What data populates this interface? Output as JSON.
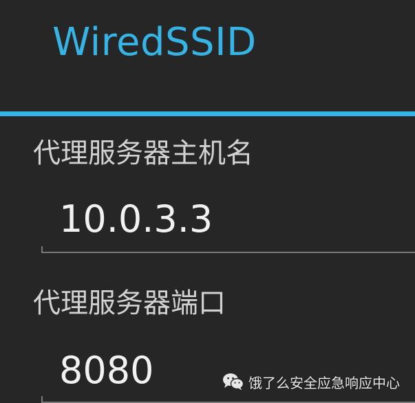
{
  "dialog": {
    "title": "WiredSSID"
  },
  "fields": {
    "proxy_host": {
      "label": "代理服务器主机名",
      "value": "10.0.3.3"
    },
    "proxy_port": {
      "label": "代理服务器端口",
      "value": "8080"
    }
  },
  "watermark": {
    "icon": "wechat-icon",
    "text": "饿了么安全应急响应中心"
  },
  "colors": {
    "accent": "#35b4e5",
    "background": "#262626",
    "label": "#d2d2d2",
    "value": "#f2f2f2"
  }
}
